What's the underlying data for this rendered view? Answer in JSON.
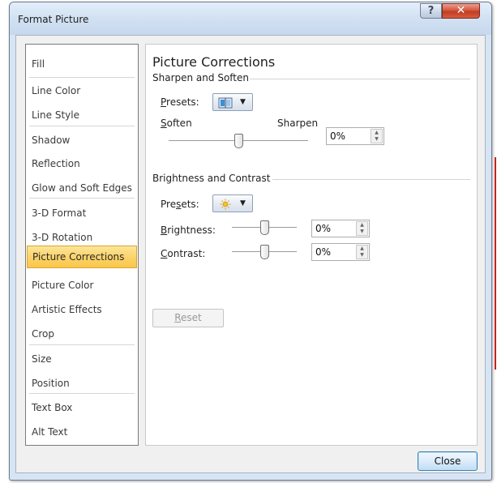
{
  "window": {
    "title": "Format Picture",
    "help_label": "?",
    "close_glyph": "✕"
  },
  "sidebar": {
    "selected": "Picture Corrections",
    "items": [
      {
        "label": "Fill"
      },
      {
        "label": "Line Color"
      },
      {
        "label": "Line Style"
      },
      {
        "label": "Shadow"
      },
      {
        "label": "Reflection"
      },
      {
        "label": "Glow and Soft Edges"
      },
      {
        "label": "3-D Format"
      },
      {
        "label": "3-D Rotation"
      },
      {
        "label": "Picture Corrections"
      },
      {
        "label": "Picture Color"
      },
      {
        "label": "Artistic Effects"
      },
      {
        "label": "Crop"
      },
      {
        "label": "Size"
      },
      {
        "label": "Position"
      },
      {
        "label": "Text Box"
      },
      {
        "label": "Alt Text"
      }
    ]
  },
  "panel": {
    "title": "Picture Corrections",
    "sharpen": {
      "heading": "Sharpen and Soften",
      "presets_label": "Presets:",
      "presets_icon": "sharpen-preset-icon",
      "soften_label": "Soften",
      "sharpen_label": "Sharpen",
      "slider_level": 0.5,
      "value": "0%"
    },
    "brightness_contrast": {
      "heading": "Brightness and Contrast",
      "presets_label": "Presets:",
      "presets_icon": "sun-icon",
      "brightness_label": "Brightness:",
      "brightness_value": "0%",
      "brightness_level": 0.5,
      "contrast_label": "Contrast:",
      "contrast_value": "0%",
      "contrast_level": 0.5
    },
    "reset_label": "Reset"
  },
  "footer": {
    "close_label": "Close"
  },
  "colors": {
    "selection": "#fbd46d",
    "title_bar": "#d3e2f3",
    "close_button": "#c23c24"
  }
}
